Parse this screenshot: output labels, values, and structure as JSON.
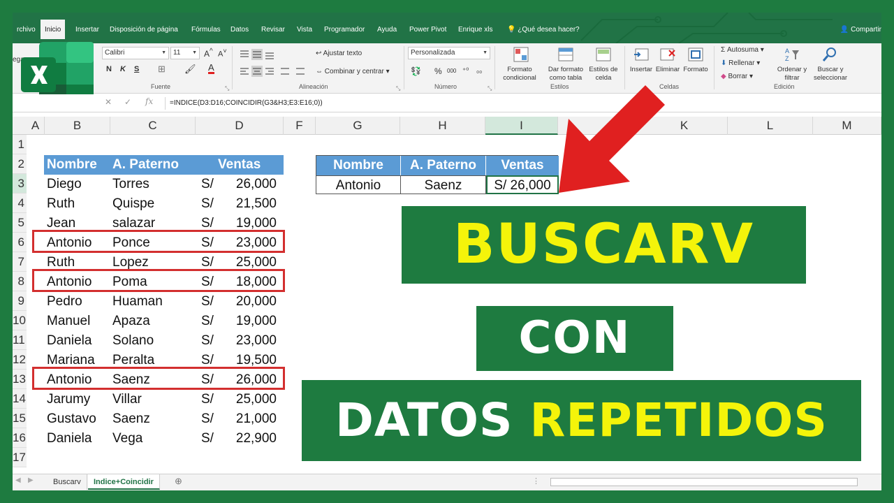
{
  "ribbon_tabs": [
    "rchivo",
    "Inicio",
    "Insertar",
    "Disposición de página",
    "Fórmulas",
    "Datos",
    "Revisar",
    "Vista",
    "Programador",
    "Ayuda",
    "Power Pivot",
    "Enrique xls"
  ],
  "active_tab": "Inicio",
  "tell_me": "¿Qué desea hacer?",
  "share": "Compartir",
  "ribbon": {
    "font_name": "Calibri",
    "font_size": "11",
    "number_format": "Personalizada",
    "wrap_text": "Ajustar texto",
    "merge_center": "Combinar y centrar",
    "groups": {
      "fuente": "Fuente",
      "alineacion": "Alineación",
      "numero": "Número",
      "estilos": "Estilos",
      "celdas": "Celdas",
      "edicion": "Edición"
    },
    "bold": "N",
    "italic": "K",
    "underline": "S",
    "percent": "%",
    "thousands": "000",
    "cond_format": "Formato condicional",
    "format_table": "Dar formato como tabla",
    "cell_styles": "Estilos de celda",
    "insert": "Insertar",
    "delete": "Eliminar",
    "format": "Formato",
    "autosum": "Autosuma",
    "fill": "Rellenar",
    "clear": "Borrar",
    "sort_filter": "Ordenar y filtrar",
    "find_select": "Buscar y seleccionar",
    "paste_partial": "ega"
  },
  "formula": "=INDICE(D3:D16;COINCIDIR(G3&H3;E3:E16;0))",
  "columns": [
    "A",
    "B",
    "C",
    "D",
    "F",
    "G",
    "H",
    "I",
    "K",
    "L",
    "M"
  ],
  "rows": [
    "1",
    "2",
    "3",
    "4",
    "5",
    "6",
    "7",
    "8",
    "9",
    "10",
    "11",
    "12",
    "13",
    "14",
    "15",
    "16",
    "17"
  ],
  "table": {
    "headers": [
      "Nombre",
      "A. Paterno",
      "Ventas"
    ],
    "currency": "S/",
    "rows": [
      [
        "Diego",
        "Torres",
        "26,000"
      ],
      [
        "Ruth",
        "Quispe",
        "21,500"
      ],
      [
        "Jean",
        "salazar",
        "19,000"
      ],
      [
        "Antonio",
        "Ponce",
        "23,000"
      ],
      [
        "Ruth",
        "Lopez",
        "25,000"
      ],
      [
        "Antonio",
        "Poma",
        "18,000"
      ],
      [
        "Pedro",
        "Huaman",
        "20,000"
      ],
      [
        "Manuel",
        "Apaza",
        "19,000"
      ],
      [
        "Daniela",
        "Solano",
        "23,000"
      ],
      [
        "Mariana",
        "Peralta",
        "19,500"
      ],
      [
        "Antonio",
        "Saenz",
        "26,000"
      ],
      [
        "Jarumy",
        "Villar",
        "25,000"
      ],
      [
        "Gustavo",
        "Saenz",
        "21,000"
      ],
      [
        "Daniela",
        "Vega",
        "22,900"
      ]
    ]
  },
  "result": {
    "headers": [
      "Nombre",
      "A. Paterno",
      "Ventas"
    ],
    "values": [
      "Antonio",
      "Saenz",
      "S/ 26,000"
    ]
  },
  "titles": {
    "line1": "BUSCARV",
    "line2": "CON",
    "line3_white": "DATOS",
    "line3_yellow": "REPETIDOS"
  },
  "sheet_tabs": [
    "Buscarv",
    "Indice+Coincidir"
  ],
  "active_sheet": "Indice+Coincidir",
  "colors": {
    "excel_green": "#217346",
    "banner_green": "#1e7b40",
    "header_blue": "#5b9bd5",
    "highlight_red": "#d32f2f",
    "title_yellow": "#f4f40a",
    "arrow_red": "#e02020"
  }
}
